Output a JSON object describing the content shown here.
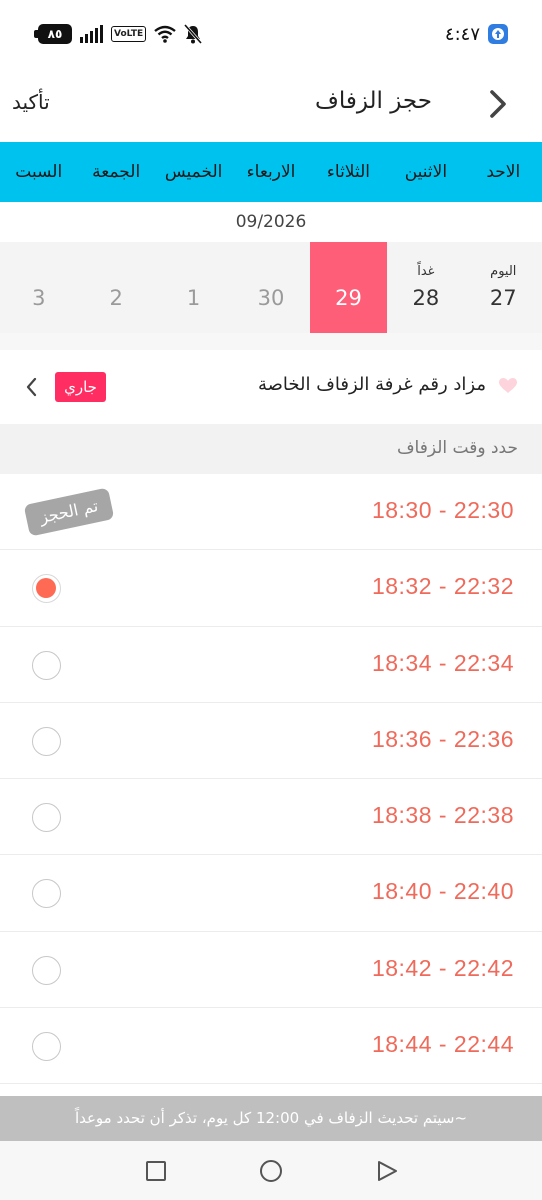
{
  "status_bar": {
    "time": "٤:٤٧",
    "battery": "٨٥",
    "network": "VoLTE"
  },
  "header": {
    "title": "حجز الزفاف",
    "confirm_label": "تأكيد",
    "back_icon": "chevron-right-icon"
  },
  "weekdays": [
    "الاحد",
    "الاثنين",
    "الثلاثاء",
    "الاربعاء",
    "الخميس",
    "الجمعة",
    "السبت"
  ],
  "calendar": {
    "month": "09/2026",
    "dates": [
      {
        "relative": "اليوم",
        "day": "27",
        "state": "normal"
      },
      {
        "relative": "غداً",
        "day": "28",
        "state": "normal"
      },
      {
        "relative": "",
        "day": "29",
        "state": "selected"
      },
      {
        "relative": "",
        "day": "30",
        "state": "disabled"
      },
      {
        "relative": "",
        "day": "1",
        "state": "disabled"
      },
      {
        "relative": "",
        "day": "2",
        "state": "disabled"
      },
      {
        "relative": "",
        "day": "3",
        "state": "disabled"
      }
    ],
    "selected_color": "#ff5e78"
  },
  "auction": {
    "text": "مزاد رقم غرفة الزفاف الخاصة",
    "badge": "جاري",
    "badge_color": "#ff2d62"
  },
  "slots_section": {
    "title": "حدد وقت الزفاف",
    "slots": [
      {
        "time": "18:30 - 22:30",
        "state": "booked",
        "booked_label": "تم الحجز"
      },
      {
        "time": "18:32 - 22:32",
        "state": "selected"
      },
      {
        "time": "18:34 - 22:34",
        "state": "available"
      },
      {
        "time": "18:36 - 22:36",
        "state": "available"
      },
      {
        "time": "18:38 - 22:38",
        "state": "available"
      },
      {
        "time": "18:40 - 22:40",
        "state": "available"
      },
      {
        "time": "18:42 - 22:42",
        "state": "available"
      },
      {
        "time": "18:44 - 22:44",
        "state": "available"
      }
    ],
    "time_color": "#ef6a5a"
  },
  "notice": "سيتم تحديث الزفاف في 12:00 كل يوم، تذكر أن تحدد موعداً~",
  "nav": [
    "recent-apps-icon",
    "home-icon",
    "back-icon"
  ]
}
